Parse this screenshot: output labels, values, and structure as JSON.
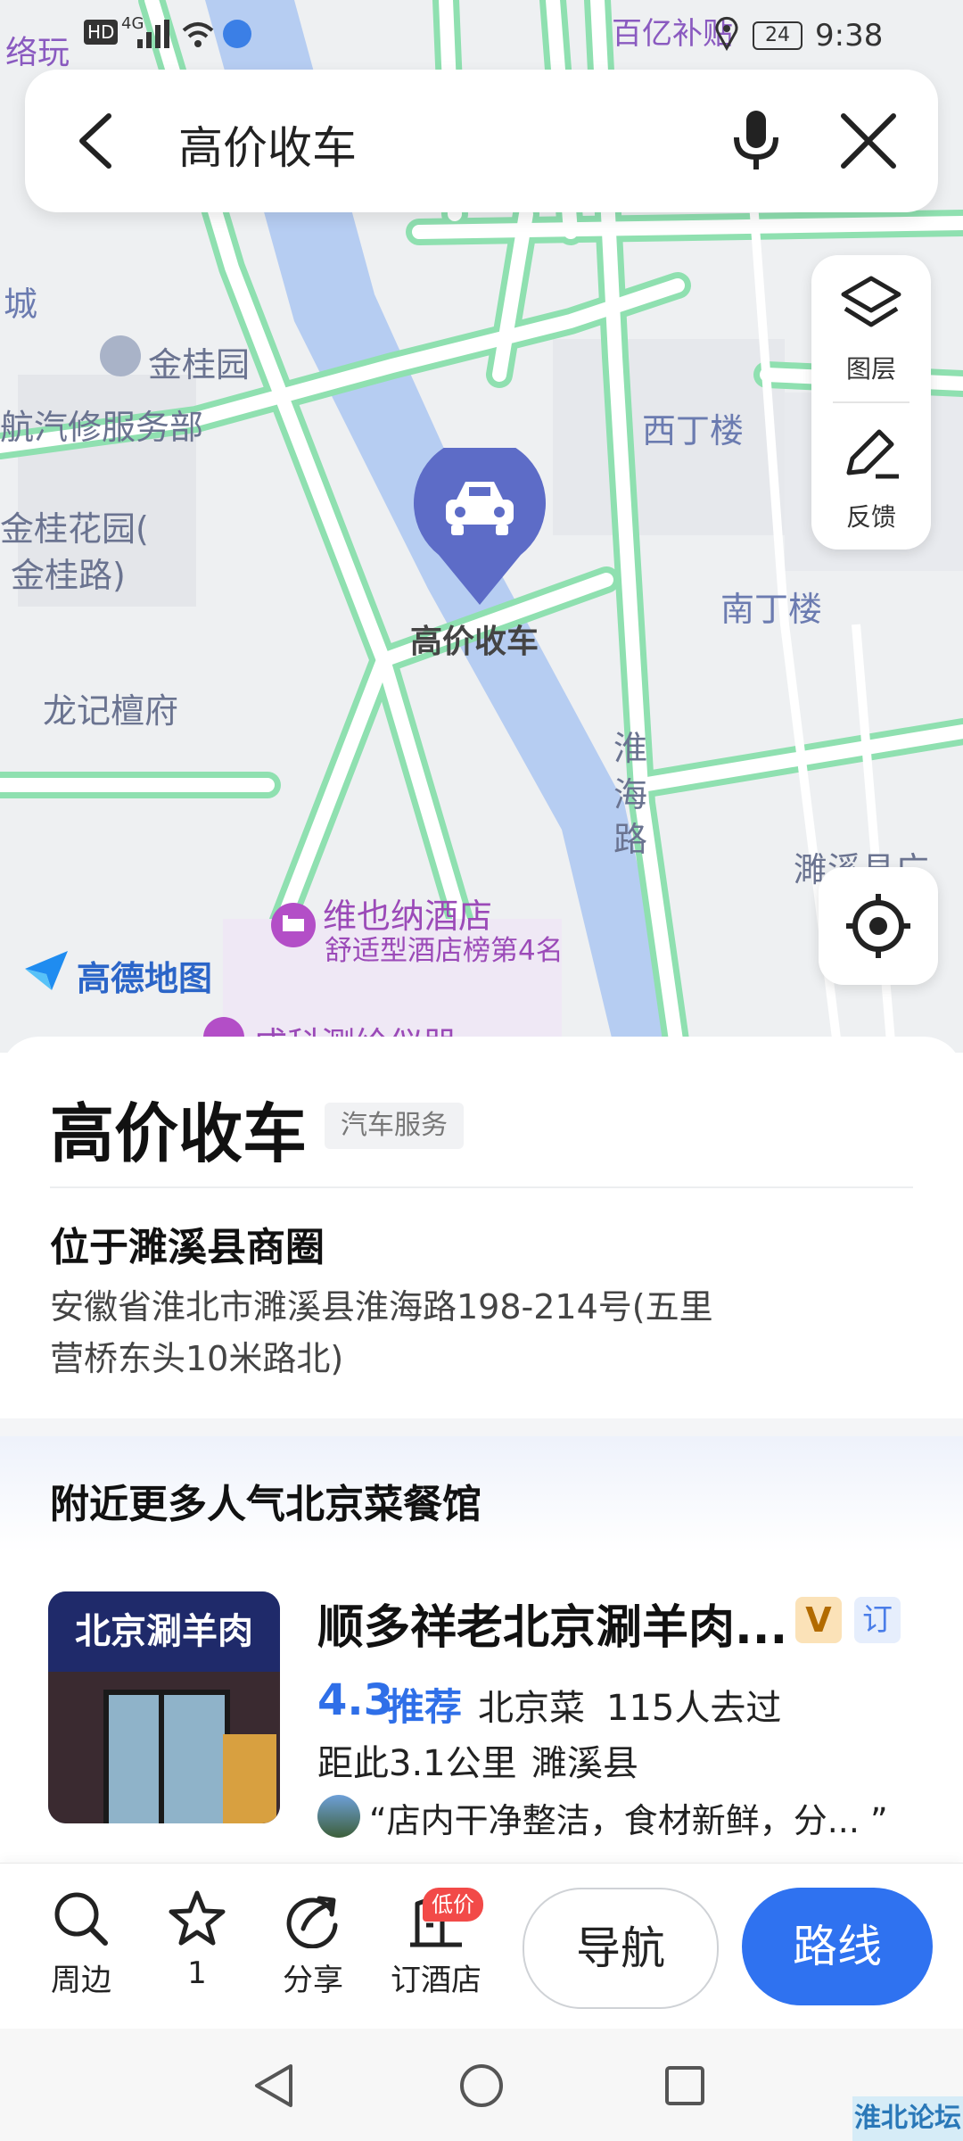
{
  "status_bar": {
    "left_text": "络玩",
    "network": "HD",
    "signal": "4G",
    "notification_text": "百亿补贴",
    "battery": "24",
    "time": "9:38"
  },
  "search": {
    "query": "高价收车"
  },
  "map": {
    "labels": {
      "cheng": "城",
      "jinguiyuan": "金桂园",
      "hangqi": "航汽修服务部",
      "jingui_huayuan_1": "金桂花园(",
      "jingui_huayuan_2": "金桂路)",
      "longji": "龙记檀府",
      "xidinglou": "西丁楼",
      "nandinglou": "南丁楼",
      "huaihai_1": "淮",
      "huaihai_2": "海",
      "huaihai_3": "路",
      "suixi": "濉溪县广",
      "hotel_name": "维也纳酒店",
      "hotel_rank": "舒适型酒店榜第4名",
      "chengke": "成科测绘仪器",
      "marker_label": "高价收车",
      "logo": "高德地图"
    },
    "controls": {
      "layers_label": "图层",
      "feedback_label": "反馈"
    }
  },
  "poi": {
    "title": "高价收车",
    "tag": "汽车服务",
    "area": "位于濉溪县商圈",
    "address": "安徽省淮北市濉溪县淮海路198-214号(五里营桥东头10米路北)"
  },
  "nearby": {
    "title": "附近更多人气北京菜餐馆",
    "restaurant": {
      "image_sign": "北京涮羊肉",
      "name": "顺多祥老北京涮羊肉...",
      "badge_v": "V",
      "badge_booking": "订",
      "rating": "4.3",
      "rating_word": "推荐",
      "cuisine": "北京菜",
      "visits": "115人去过",
      "distance": "距此3.1公里",
      "county": "濉溪县",
      "review": "“店内干净整洁，食材新鲜，分... ”"
    }
  },
  "actions": {
    "nearby": "周边",
    "favorite": "1",
    "share": "分享",
    "hotel": "订酒店",
    "hotel_badge": "低价",
    "navigate": "导航",
    "route": "路线"
  },
  "watermark": "淮北论坛",
  "colors": {
    "road": "#8fe0b0",
    "river": "#b6cdf2",
    "marker": "#5d6cc7",
    "accent": "#2f72f0",
    "badge_red": "#f24a48"
  }
}
